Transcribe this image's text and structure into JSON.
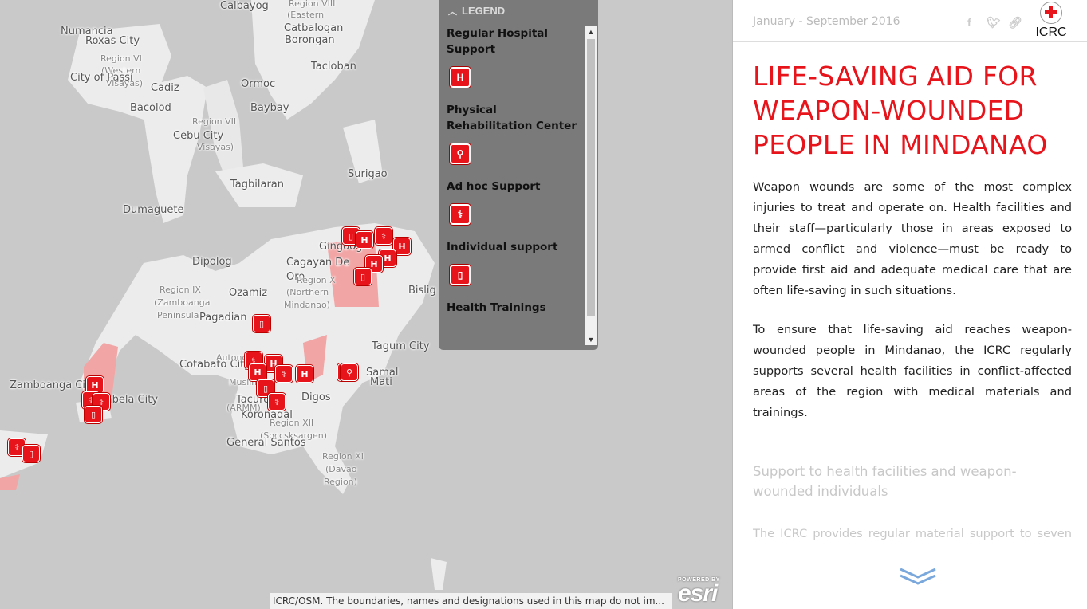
{
  "map": {
    "places": [
      {
        "name": "Calbayog",
        "cls": ""
      },
      {
        "name": "Numancia",
        "cls": ""
      },
      {
        "name": "Roxas City",
        "cls": ""
      },
      {
        "name": "Region VI",
        "cls": "small"
      },
      {
        "name": "(Western",
        "cls": "small"
      },
      {
        "name": "City of Passi",
        "cls": ""
      },
      {
        "name": "Visayas)",
        "cls": "small"
      },
      {
        "name": "Cadiz",
        "cls": ""
      },
      {
        "name": "Bacolod",
        "cls": ""
      },
      {
        "name": "Region VIII",
        "cls": "small"
      },
      {
        "name": "(Eastern",
        "cls": "small"
      },
      {
        "name": "Catbalogan",
        "cls": ""
      },
      {
        "name": "Borongan",
        "cls": ""
      },
      {
        "name": "Tacloban",
        "cls": ""
      },
      {
        "name": "Ormoc",
        "cls": ""
      },
      {
        "name": "Baybay",
        "cls": ""
      },
      {
        "name": "Region VII",
        "cls": "small"
      },
      {
        "name": "Cebu City",
        "cls": ""
      },
      {
        "name": "Visayas)",
        "cls": "small"
      },
      {
        "name": "Tagbilaran",
        "cls": ""
      },
      {
        "name": "Dumaguete",
        "cls": ""
      },
      {
        "name": "Surigao",
        "cls": ""
      },
      {
        "name": "Dipolog",
        "cls": ""
      },
      {
        "name": "Cagayan De",
        "cls": ""
      },
      {
        "name": "Oro",
        "cls": ""
      },
      {
        "name": "Region X",
        "cls": "small"
      },
      {
        "name": "(Northern",
        "cls": "small"
      },
      {
        "name": "Mindanao)",
        "cls": "small"
      },
      {
        "name": "Region IX",
        "cls": "small"
      },
      {
        "name": "(Zamboanga",
        "cls": "small"
      },
      {
        "name": "Peninsula",
        "cls": "small"
      },
      {
        "name": "Ozamiz",
        "cls": ""
      },
      {
        "name": "Pagadian",
        "cls": ""
      },
      {
        "name": "Bislig",
        "cls": ""
      },
      {
        "name": "Tagum City",
        "cls": ""
      },
      {
        "name": "Cotabato City",
        "cls": ""
      },
      {
        "name": "Samal",
        "cls": ""
      },
      {
        "name": "Mati",
        "cls": ""
      },
      {
        "name": "Zamboanga City",
        "cls": ""
      },
      {
        "name": "Isabela City",
        "cls": ""
      },
      {
        "name": "Tacurong",
        "cls": ""
      },
      {
        "name": "Koronadal",
        "cls": ""
      },
      {
        "name": "Digos",
        "cls": ""
      },
      {
        "name": "Region XII",
        "cls": "small"
      },
      {
        "name": "(Soccsksargen)",
        "cls": "small"
      },
      {
        "name": "General Santos",
        "cls": ""
      },
      {
        "name": "Region XI",
        "cls": "small"
      },
      {
        "name": "(Davao",
        "cls": "small"
      },
      {
        "name": "Region)",
        "cls": "small"
      },
      {
        "name": "Autonomous",
        "cls": "small"
      },
      {
        "name": "Muslim",
        "cls": "small"
      },
      {
        "name": "(ARMM)",
        "cls": "small"
      },
      {
        "name": "Gingoog",
        "cls": ""
      }
    ],
    "markers": [
      {
        "type": "individual",
        "symbol": "▯"
      },
      {
        "type": "adhoc",
        "symbol": "⚕"
      },
      {
        "type": "hospital",
        "symbol": "H"
      },
      {
        "type": "hospital",
        "symbol": "H"
      },
      {
        "type": "hospital",
        "symbol": "H"
      },
      {
        "type": "hospital",
        "symbol": "H"
      },
      {
        "type": "individual",
        "symbol": "▯"
      },
      {
        "type": "individual",
        "symbol": "▯"
      },
      {
        "type": "adhoc",
        "symbol": "⚕"
      },
      {
        "type": "hospital",
        "symbol": "H"
      },
      {
        "type": "hospital",
        "symbol": "H"
      },
      {
        "type": "adhoc",
        "symbol": "⚕"
      },
      {
        "type": "individual",
        "symbol": "▯"
      },
      {
        "type": "adhoc",
        "symbol": "⚕"
      },
      {
        "type": "hospital",
        "symbol": "H"
      },
      {
        "type": "adhoc",
        "symbol": "⚕"
      },
      {
        "type": "rehab",
        "symbol": "⚲"
      },
      {
        "type": "hospital",
        "symbol": "H"
      },
      {
        "type": "adhoc",
        "symbol": "⚕"
      },
      {
        "type": "adhoc",
        "symbol": "⚕"
      },
      {
        "type": "individual",
        "symbol": "▯"
      },
      {
        "type": "adhoc",
        "symbol": "⚕"
      },
      {
        "type": "individual",
        "symbol": "▯"
      }
    ]
  },
  "legend": {
    "header": "LEGEND",
    "items": [
      {
        "label": "Regular Hospital Support",
        "icon": "hospital-icon",
        "symbol": "H"
      },
      {
        "label": "Physical Rehabilitation Center",
        "icon": "rehab-icon",
        "symbol": "⚲"
      },
      {
        "label": "Ad hoc Support",
        "icon": "medical-icon",
        "symbol": "⚕"
      },
      {
        "label": "Individual support",
        "icon": "individual-icon",
        "symbol": "▯"
      },
      {
        "label": "Health Trainings",
        "icon": "training-icon",
        "symbol": ""
      }
    ]
  },
  "attribution": "ICRC/OSM. The boundaries, names and designations used in this map do not im...",
  "esri": {
    "powered": "POWERED BY",
    "name": "esri"
  },
  "panel": {
    "date": "January - September 2016",
    "logo_text": "ICRC",
    "title": "LIFE-SAVING AID FOR WEAPON-WOUNDED PEOPLE IN MINDANAO",
    "paragraphs": [
      "Weapon wounds are some of the most complex injuries to treat and operate on. Health facilities and their staff—particularly those in areas exposed to armed conflict and violence—must be ready to provide first aid and adequate medical care that are often life-saving in such situations.",
      "To ensure that life-saving aid reaches weapon-wounded people in Mindanao, the ICRC regularly supports several health facilities in conflict-affected areas of the region with medical materials and trainings."
    ],
    "subhead": "Support to health facilities and weapon-wounded individuals",
    "faded_para": "The ICRC provides regular material support to seven hospitals in the conflict-affected areas of the region."
  },
  "colors": {
    "accent": "#e8141c",
    "map_sea": "#c9c9c9",
    "map_land": "#ececec",
    "highlight": "#f2a5a5"
  }
}
